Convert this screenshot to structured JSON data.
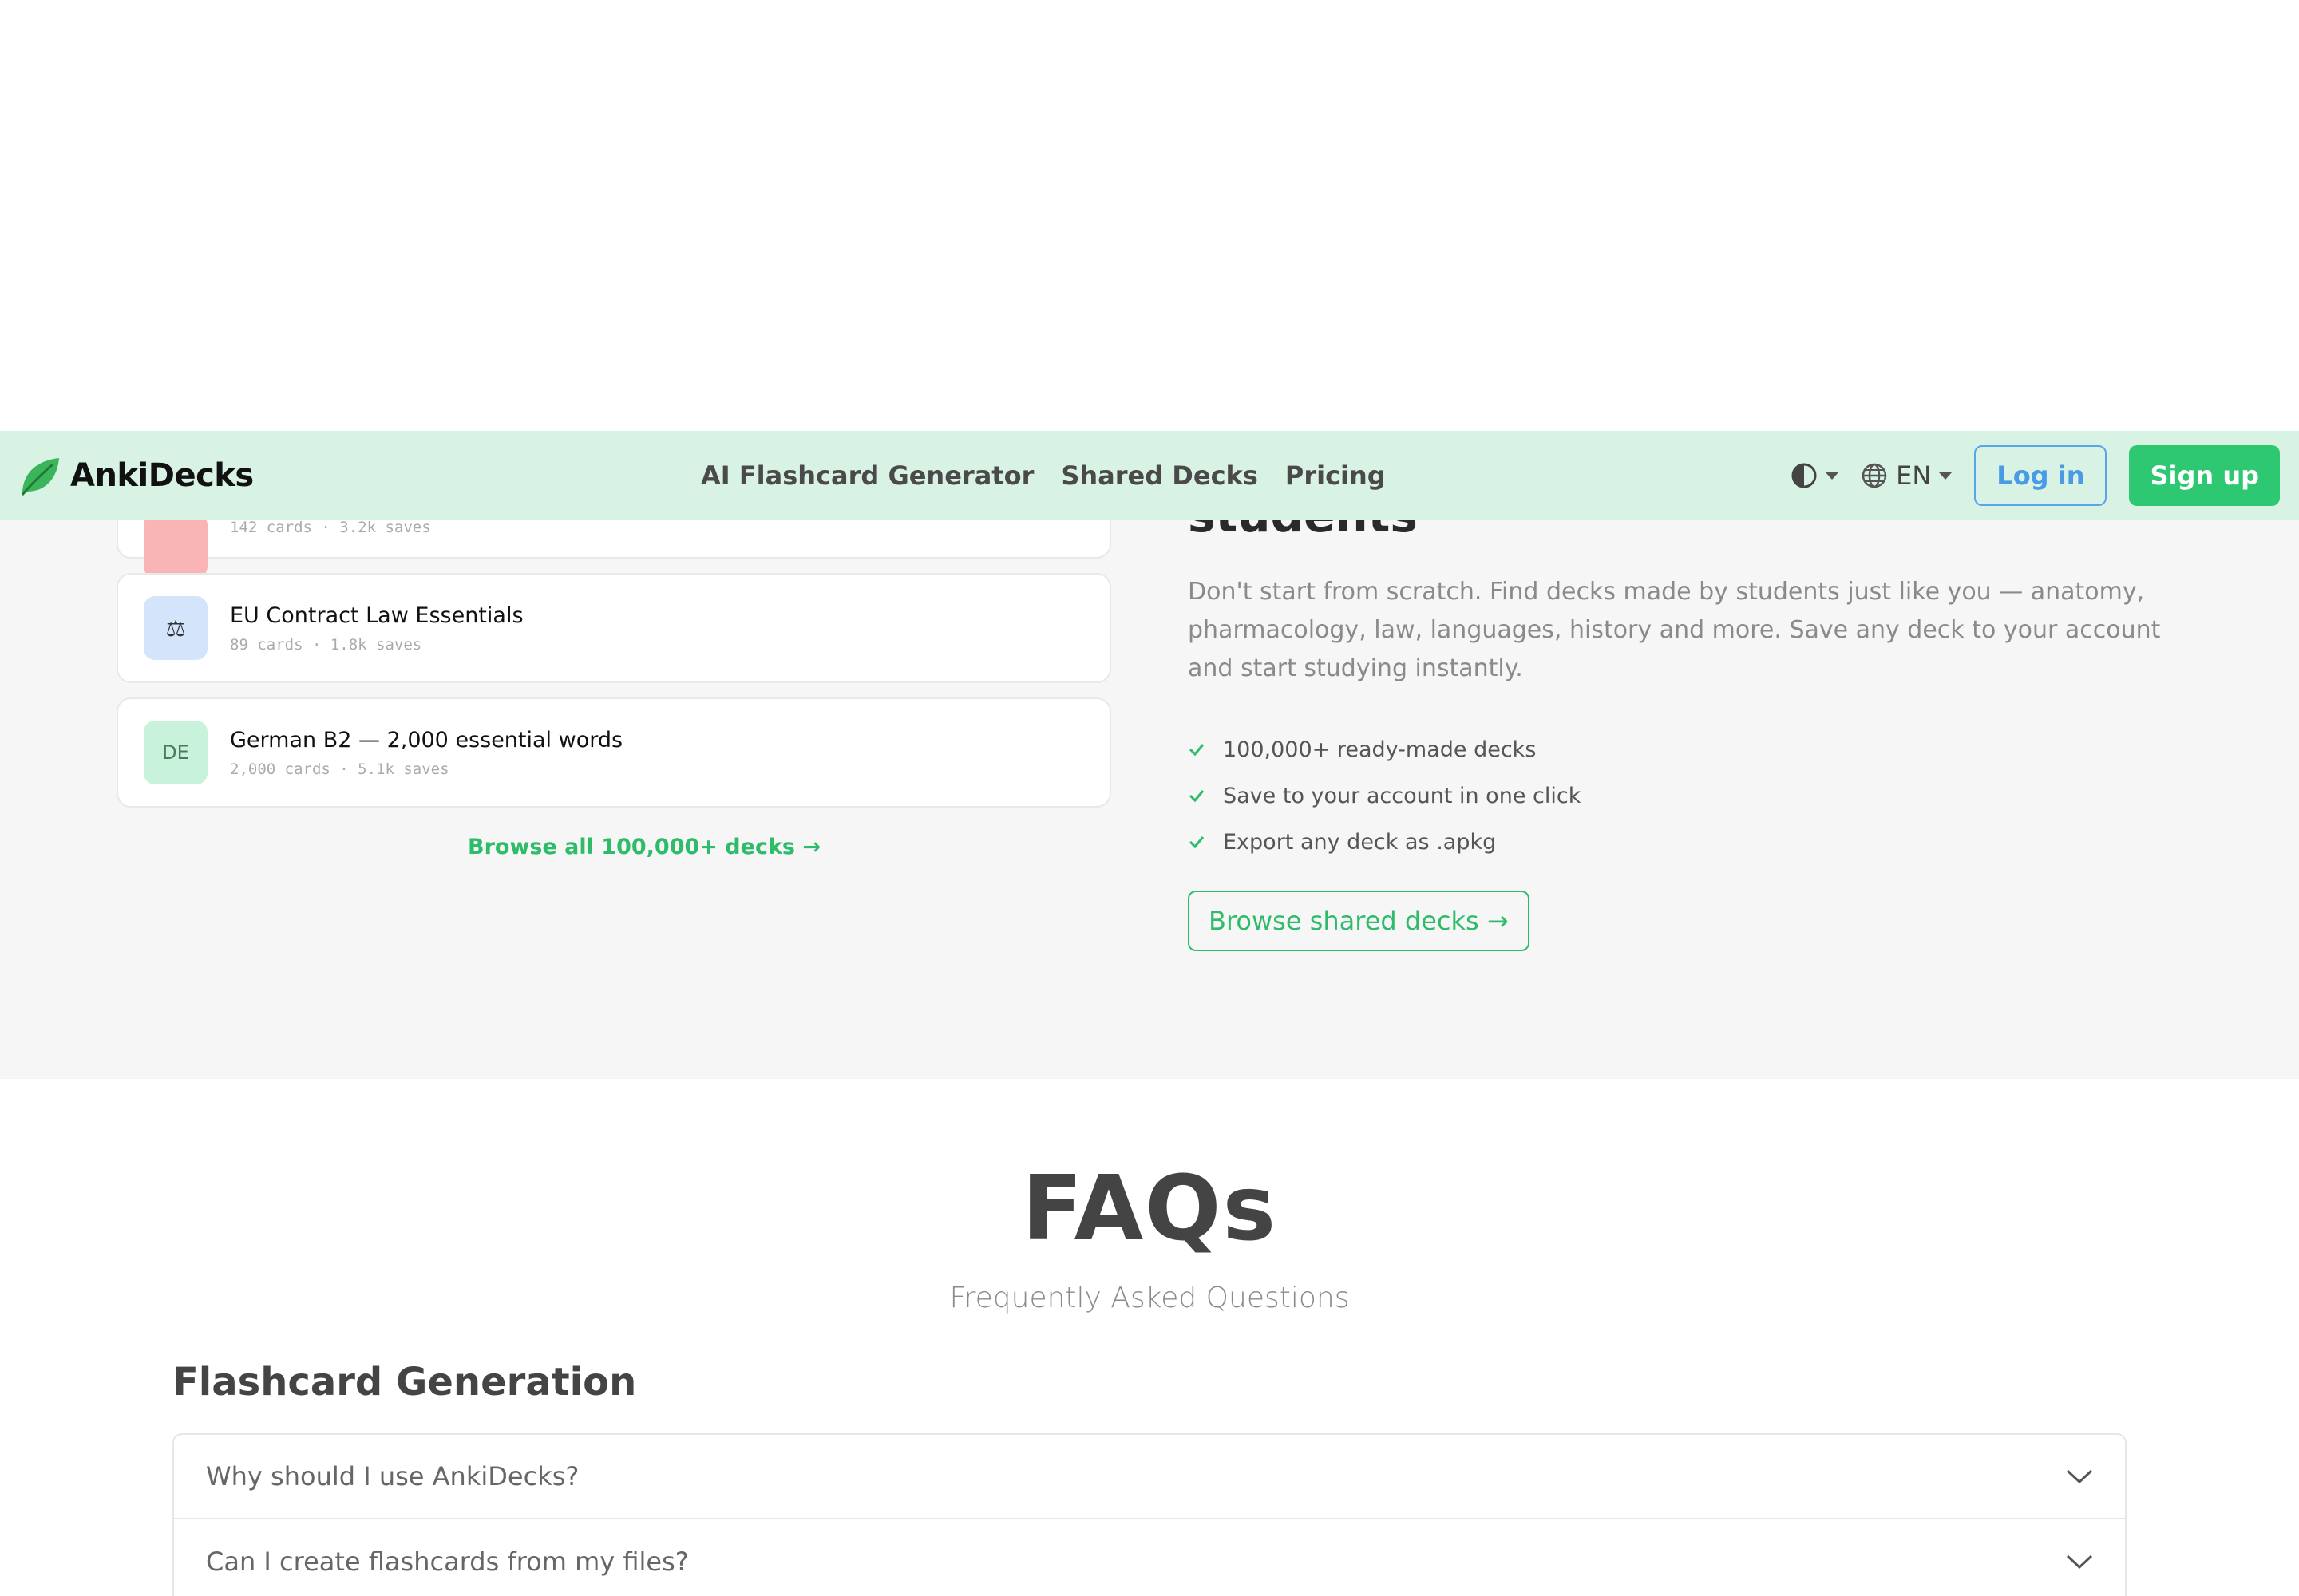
{
  "header": {
    "brand": "AnkiDecks",
    "nav": [
      {
        "label": "AI Flashcard Generator"
      },
      {
        "label": "Shared Decks"
      },
      {
        "label": "Pricing"
      }
    ],
    "language": "EN",
    "login_label": "Log in",
    "signup_label": "Sign up",
    "colors": {
      "bar": "#d8f3e3",
      "accent": "#2ec772",
      "login": "#4a9be6"
    }
  },
  "shared": {
    "decks": [
      {
        "title": "",
        "meta": "142 cards · 3.2k saves",
        "thumb": "",
        "thumb_color": "#f9b5b5"
      },
      {
        "title": "EU Contract Law Essentials",
        "meta": "89 cards · 1.8k saves",
        "thumb": "⚖",
        "thumb_color": "#d3e4fb"
      },
      {
        "title": "German B2 — 2,000 essential words",
        "meta": "2,000 cards · 5.1k saves",
        "thumb": "DE",
        "thumb_color": "#c9f2dc"
      }
    ],
    "browse_all": "Browse all 100,000+ decks →",
    "heading_partial": "students",
    "description": "Don't start from scratch. Find decks made by students just like you — anatomy, pharmacology, law, languages, history and more. Save any deck to your account and start studying instantly.",
    "features": [
      "100,000+ ready-made decks",
      "Save to your account in one click",
      "Export any deck as .apkg"
    ],
    "cta": "Browse shared decks →"
  },
  "faq": {
    "title": "FAQs",
    "subtitle": "Frequently Asked Questions",
    "category": "Flashcard Generation",
    "questions": [
      "Why should I use AnkiDecks?",
      "Can I create flashcards from my files?"
    ]
  }
}
